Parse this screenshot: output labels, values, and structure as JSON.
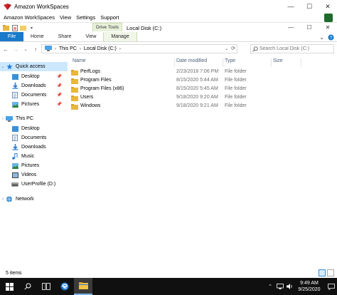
{
  "workspaces": {
    "title": "Amazon WorkSpaces",
    "menu": [
      "Amazon WorkSpaces",
      "View",
      "Settings",
      "Support"
    ],
    "controls": [
      "—",
      "☐",
      "✕"
    ]
  },
  "explorer": {
    "context_tab": "Drive Tools",
    "window_title": "Local Disk (C:)",
    "controls": [
      "—",
      "☐",
      "✕"
    ],
    "ribbon_tabs": [
      "File",
      "Home",
      "Share",
      "View",
      "Manage"
    ],
    "address": {
      "segments": [
        "This PC",
        "Local Disk (C:)"
      ]
    },
    "search": {
      "placeholder": "Search Local Disk (C:)"
    },
    "columns": [
      "Name",
      "Date modified",
      "Type",
      "Size"
    ],
    "files": [
      {
        "name": "PerfLogs",
        "date": "2/23/2018 7:06 PM",
        "type": "File folder"
      },
      {
        "name": "Program Files",
        "date": "8/15/2020 5:44 AM",
        "type": "File folder"
      },
      {
        "name": "Program Files (x86)",
        "date": "8/15/2020 5:45 AM",
        "type": "File folder"
      },
      {
        "name": "Users",
        "date": "9/18/2020 9:20 AM",
        "type": "File folder"
      },
      {
        "name": "Windows",
        "date": "9/18/2020 9:21 AM",
        "type": "File folder"
      }
    ],
    "nav": {
      "quick_access": "Quick access",
      "quick_items": [
        "Desktop",
        "Downloads",
        "Documents",
        "Pictures"
      ],
      "this_pc": "This PC",
      "pc_items": [
        "Desktop",
        "Documents",
        "Downloads",
        "Music",
        "Pictures",
        "Videos",
        "UserProfile (D:)"
      ],
      "network": "Network"
    },
    "status": "5 items"
  },
  "taskbar": {
    "time": "9:49 AM",
    "date": "9/25/2020"
  },
  "colors": {
    "accent": "#1979ca",
    "selection": "#cce8ff",
    "folder": "#e8b83c",
    "taskbar": "#101010"
  }
}
